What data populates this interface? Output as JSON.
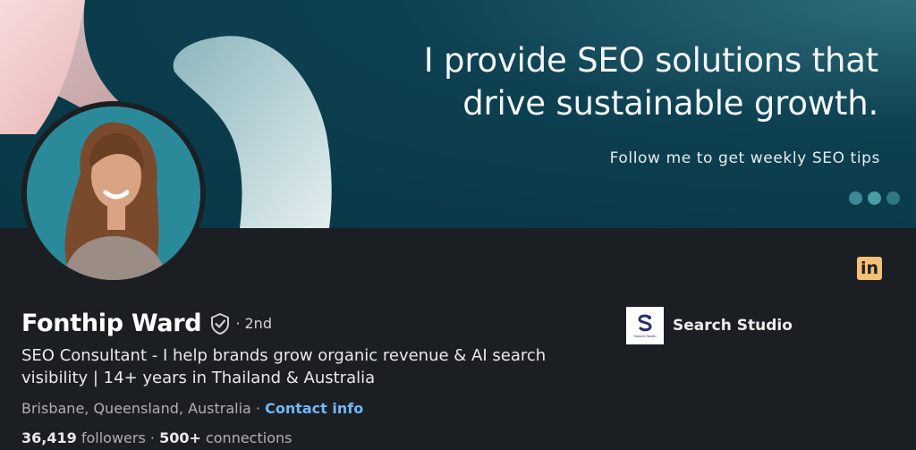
{
  "banner": {
    "headline_line1": "I provide SEO solutions that",
    "headline_line2": "drive sustainable growth.",
    "subline": "Follow me to get weekly SEO tips",
    "dot_colors": [
      "#3a8a96",
      "#4a9ca6",
      "#2d7884"
    ],
    "background_color": "#083645"
  },
  "profile": {
    "name": "Fonthip Ward",
    "degree": "· 2nd",
    "headline": "SEO Consultant - I help brands grow organic revenue & AI search visibility | 14+ years in Thailand & Australia",
    "location": "Brisbane, Queensland, Australia",
    "location_separator": " · ",
    "contact_link": "Contact info",
    "followers_count": "36,419",
    "followers_label": "followers",
    "stats_separator": " · ",
    "connections_count": "500+",
    "connections_label": "connections"
  },
  "company": {
    "name": "Search Studio",
    "logo_glyph": "S",
    "logo_caption": "Search Studio"
  },
  "icons": {
    "linkedin": "in",
    "verified": "verified-shield-icon"
  },
  "colors": {
    "page_bg": "#1b1f23",
    "link": "#71b7fb",
    "linkedin_badge": "#f5c075"
  }
}
